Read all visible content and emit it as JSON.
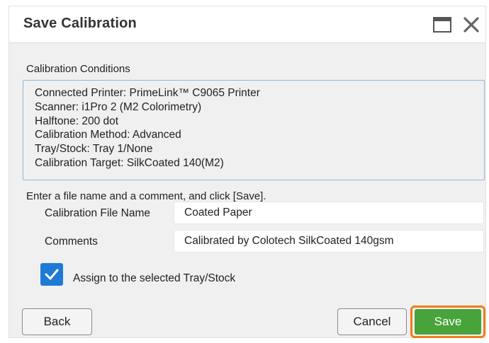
{
  "dialog": {
    "title": "Save Calibration",
    "conditions_label": "Calibration Conditions",
    "conditions": [
      "Connected Printer: PrimeLink™ C9065 Printer",
      "Scanner: i1Pro 2 (M2 Colorimetry)",
      "Halftone: 200 dot",
      "Calibration Method: Advanced",
      "Tray/Stock: Tray 1/None",
      "Calibration Target: SilkCoated 140(M2)"
    ],
    "instruction": "Enter a file name and a comment, and click [Save].",
    "file_name_label": "Calibration File Name",
    "file_name_value": "Coated Paper",
    "comments_label": "Comments",
    "comments_value": "Calibrated by Colotech SilkCoated 140gsm",
    "assign_label": "Assign to the selected Tray/Stock",
    "assign_checked": true,
    "back_label": "Back",
    "cancel_label": "Cancel",
    "save_label": "Save"
  },
  "icons": {
    "window": "window-icon",
    "close": "close-icon",
    "check": "checkmark-icon"
  },
  "colors": {
    "accent_blue": "#1f7ad6",
    "save_green": "#48a33a",
    "highlight_orange": "#f07d1b",
    "conditions_border": "#8fb7e0"
  }
}
